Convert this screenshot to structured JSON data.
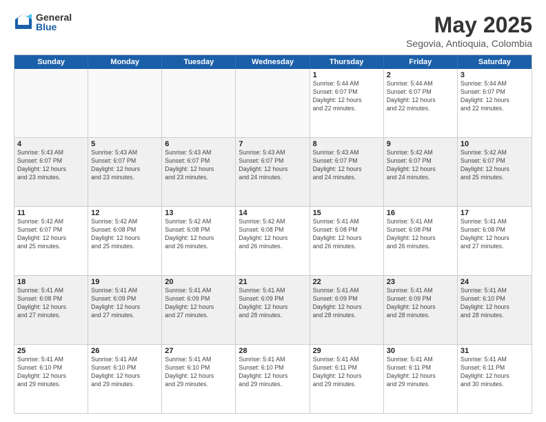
{
  "logo": {
    "general": "General",
    "blue": "Blue"
  },
  "title": {
    "month_year": "May 2025",
    "location": "Segovia, Antioquia, Colombia"
  },
  "weekdays": [
    "Sunday",
    "Monday",
    "Tuesday",
    "Wednesday",
    "Thursday",
    "Friday",
    "Saturday"
  ],
  "rows": [
    {
      "cells": [
        {
          "day": "",
          "info": "",
          "empty": true
        },
        {
          "day": "",
          "info": "",
          "empty": true
        },
        {
          "day": "",
          "info": "",
          "empty": true
        },
        {
          "day": "",
          "info": "",
          "empty": true
        },
        {
          "day": "1",
          "info": "Sunrise: 5:44 AM\nSunset: 6:07 PM\nDaylight: 12 hours\nand 22 minutes."
        },
        {
          "day": "2",
          "info": "Sunrise: 5:44 AM\nSunset: 6:07 PM\nDaylight: 12 hours\nand 22 minutes."
        },
        {
          "day": "3",
          "info": "Sunrise: 5:44 AM\nSunset: 6:07 PM\nDaylight: 12 hours\nand 22 minutes."
        }
      ],
      "alt": false
    },
    {
      "cells": [
        {
          "day": "4",
          "info": "Sunrise: 5:43 AM\nSunset: 6:07 PM\nDaylight: 12 hours\nand 23 minutes."
        },
        {
          "day": "5",
          "info": "Sunrise: 5:43 AM\nSunset: 6:07 PM\nDaylight: 12 hours\nand 23 minutes."
        },
        {
          "day": "6",
          "info": "Sunrise: 5:43 AM\nSunset: 6:07 PM\nDaylight: 12 hours\nand 23 minutes."
        },
        {
          "day": "7",
          "info": "Sunrise: 5:43 AM\nSunset: 6:07 PM\nDaylight: 12 hours\nand 24 minutes."
        },
        {
          "day": "8",
          "info": "Sunrise: 5:43 AM\nSunset: 6:07 PM\nDaylight: 12 hours\nand 24 minutes."
        },
        {
          "day": "9",
          "info": "Sunrise: 5:42 AM\nSunset: 6:07 PM\nDaylight: 12 hours\nand 24 minutes."
        },
        {
          "day": "10",
          "info": "Sunrise: 5:42 AM\nSunset: 6:07 PM\nDaylight: 12 hours\nand 25 minutes."
        }
      ],
      "alt": true
    },
    {
      "cells": [
        {
          "day": "11",
          "info": "Sunrise: 5:42 AM\nSunset: 6:07 PM\nDaylight: 12 hours\nand 25 minutes."
        },
        {
          "day": "12",
          "info": "Sunrise: 5:42 AM\nSunset: 6:08 PM\nDaylight: 12 hours\nand 25 minutes."
        },
        {
          "day": "13",
          "info": "Sunrise: 5:42 AM\nSunset: 6:08 PM\nDaylight: 12 hours\nand 26 minutes."
        },
        {
          "day": "14",
          "info": "Sunrise: 5:42 AM\nSunset: 6:08 PM\nDaylight: 12 hours\nand 26 minutes."
        },
        {
          "day": "15",
          "info": "Sunrise: 5:41 AM\nSunset: 6:08 PM\nDaylight: 12 hours\nand 26 minutes."
        },
        {
          "day": "16",
          "info": "Sunrise: 5:41 AM\nSunset: 6:08 PM\nDaylight: 12 hours\nand 26 minutes."
        },
        {
          "day": "17",
          "info": "Sunrise: 5:41 AM\nSunset: 6:08 PM\nDaylight: 12 hours\nand 27 minutes."
        }
      ],
      "alt": false
    },
    {
      "cells": [
        {
          "day": "18",
          "info": "Sunrise: 5:41 AM\nSunset: 6:08 PM\nDaylight: 12 hours\nand 27 minutes."
        },
        {
          "day": "19",
          "info": "Sunrise: 5:41 AM\nSunset: 6:09 PM\nDaylight: 12 hours\nand 27 minutes."
        },
        {
          "day": "20",
          "info": "Sunrise: 5:41 AM\nSunset: 6:09 PM\nDaylight: 12 hours\nand 27 minutes."
        },
        {
          "day": "21",
          "info": "Sunrise: 5:41 AM\nSunset: 6:09 PM\nDaylight: 12 hours\nand 28 minutes."
        },
        {
          "day": "22",
          "info": "Sunrise: 5:41 AM\nSunset: 6:09 PM\nDaylight: 12 hours\nand 28 minutes."
        },
        {
          "day": "23",
          "info": "Sunrise: 5:41 AM\nSunset: 6:09 PM\nDaylight: 12 hours\nand 28 minutes."
        },
        {
          "day": "24",
          "info": "Sunrise: 5:41 AM\nSunset: 6:10 PM\nDaylight: 12 hours\nand 28 minutes."
        }
      ],
      "alt": true
    },
    {
      "cells": [
        {
          "day": "25",
          "info": "Sunrise: 5:41 AM\nSunset: 6:10 PM\nDaylight: 12 hours\nand 29 minutes."
        },
        {
          "day": "26",
          "info": "Sunrise: 5:41 AM\nSunset: 6:10 PM\nDaylight: 12 hours\nand 29 minutes."
        },
        {
          "day": "27",
          "info": "Sunrise: 5:41 AM\nSunset: 6:10 PM\nDaylight: 12 hours\nand 29 minutes."
        },
        {
          "day": "28",
          "info": "Sunrise: 5:41 AM\nSunset: 6:10 PM\nDaylight: 12 hours\nand 29 minutes."
        },
        {
          "day": "29",
          "info": "Sunrise: 5:41 AM\nSunset: 6:11 PM\nDaylight: 12 hours\nand 29 minutes."
        },
        {
          "day": "30",
          "info": "Sunrise: 5:41 AM\nSunset: 6:11 PM\nDaylight: 12 hours\nand 29 minutes."
        },
        {
          "day": "31",
          "info": "Sunrise: 5:41 AM\nSunset: 6:11 PM\nDaylight: 12 hours\nand 30 minutes."
        }
      ],
      "alt": false
    }
  ]
}
